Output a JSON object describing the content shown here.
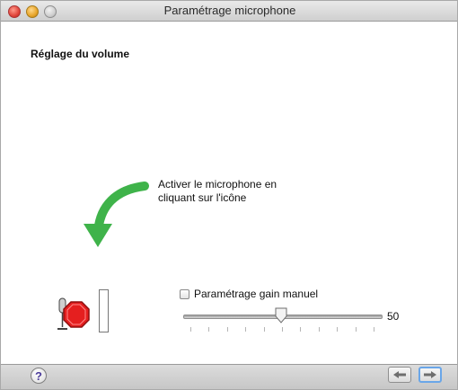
{
  "window": {
    "title": "Paramétrage microphone"
  },
  "content": {
    "section_title": "Réglage du volume",
    "instruction_line1": "Activer le microphone en",
    "instruction_line2": "cliquant sur l'icône"
  },
  "controls": {
    "manual_gain_label": "Paramétrage gain manuel",
    "manual_gain_checked": false,
    "gain_slider": {
      "min": 0,
      "max": 100,
      "value": 50,
      "value_label": "50"
    }
  },
  "footer": {
    "help_label": "?",
    "help_icon": "question-mark-icon",
    "prev_icon": "arrow-left-icon",
    "next_icon": "arrow-right-icon"
  },
  "colors": {
    "arrow_green": "#3fb34a",
    "mic_stop_red": "#e51f1f",
    "focus_blue": "#6aa6e8"
  }
}
